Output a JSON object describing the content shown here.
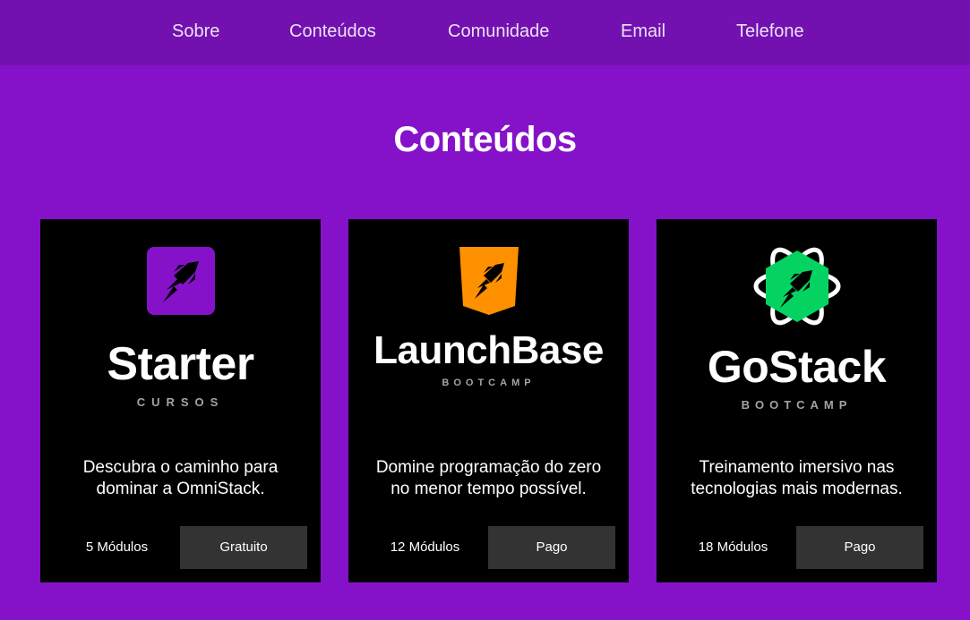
{
  "nav": {
    "items": [
      {
        "label": "Sobre"
      },
      {
        "label": "Conteúdos"
      },
      {
        "label": "Comunidade"
      },
      {
        "label": "Email"
      },
      {
        "label": "Telefone"
      }
    ]
  },
  "main": {
    "title": "Conteúdos"
  },
  "colors": {
    "page_background": "#8512c8",
    "header_background": "#7311b0",
    "card_background": "#000000",
    "price_button_background": "#333333",
    "starter_accent": "#8512c8",
    "launchbase_accent": "#ff9000",
    "gostack_accent": "#04d361"
  },
  "cards": [
    {
      "icon": "starter-rocket-icon",
      "brand": "Starter",
      "kind": "CURSOS",
      "description": "Descubra o caminho para dominar a OmniStack.",
      "modules": "5 Módulos",
      "price": "Gratuito"
    },
    {
      "icon": "launchbase-rocket-icon",
      "brand": "LaunchBase",
      "kind": "BOOTCAMP",
      "description": "Domine programação do zero no menor tempo possível.",
      "modules": "12 Módulos",
      "price": "Pago"
    },
    {
      "icon": "gostack-rocket-icon",
      "brand": "GoStack",
      "kind": "BOOTCAMP",
      "description": "Treinamento imersivo nas tecnologias mais modernas.",
      "modules": "18 Módulos",
      "price": "Pago"
    }
  ]
}
